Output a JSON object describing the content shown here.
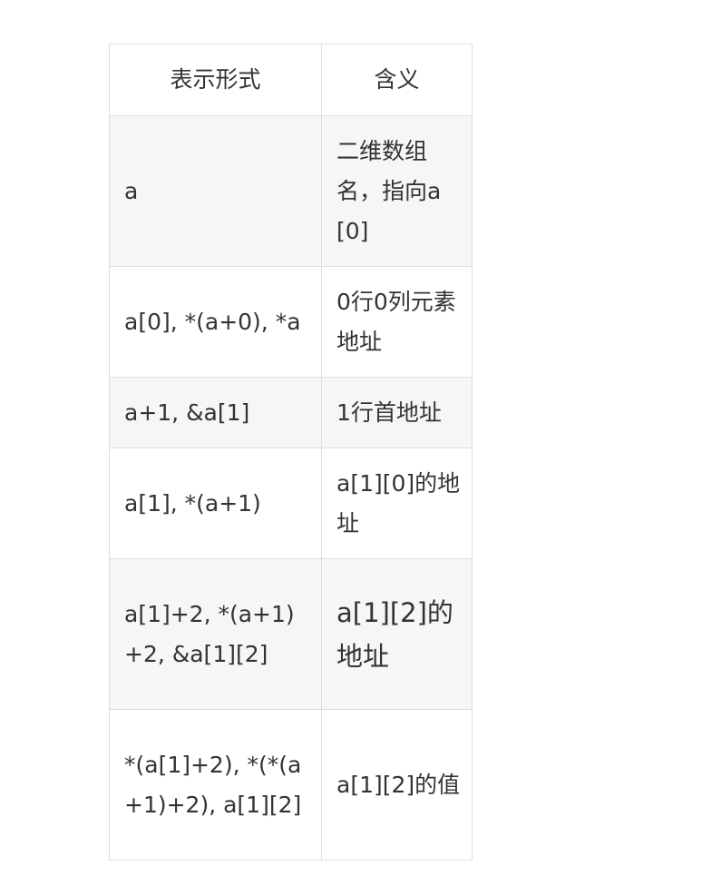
{
  "table": {
    "headers": [
      "表示形式",
      "含义"
    ],
    "rows": [
      [
        "a",
        "二维数组名，指向a[0]"
      ],
      [
        "a[0], *(a+0), *a",
        "0行0列元素地址"
      ],
      [
        "a+1, &a[1]",
        "1行首地址"
      ],
      [
        "a[1], *(a+1)",
        "a[1][0]的地址"
      ],
      [
        "a[1]+2, *(a+1)+2, &a[1][2]",
        "a[1][2]的地址"
      ],
      [
        "*(a[1]+2), *(*(a+1)+2), a[1][2]",
        "a[1][2]的值"
      ]
    ]
  }
}
